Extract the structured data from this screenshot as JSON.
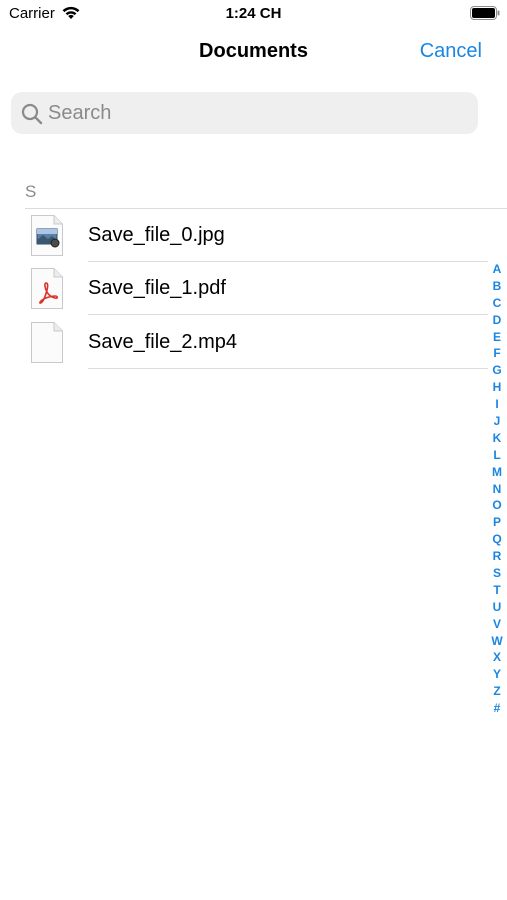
{
  "status_bar": {
    "carrier": "Carrier",
    "time": "1:24 CH"
  },
  "nav": {
    "title": "Documents",
    "cancel_label": "Cancel"
  },
  "search": {
    "placeholder": "Search",
    "value": ""
  },
  "section": {
    "header": "S"
  },
  "files": [
    {
      "name": "Save_file_0.jpg",
      "icon": "image-file-icon"
    },
    {
      "name": "Save_file_1.pdf",
      "icon": "pdf-file-icon"
    },
    {
      "name": "Save_file_2.mp4",
      "icon": "generic-file-icon"
    }
  ],
  "index": [
    "A",
    "B",
    "C",
    "D",
    "E",
    "F",
    "G",
    "H",
    "I",
    "J",
    "K",
    "L",
    "M",
    "N",
    "O",
    "P",
    "Q",
    "R",
    "S",
    "T",
    "U",
    "V",
    "W",
    "X",
    "Y",
    "Z",
    "#"
  ],
  "colors": {
    "accent": "#1a86e3",
    "search_bg": "#efeff0",
    "secondary_text": "#8a8a8e",
    "separator": "#dcdcde",
    "pdf_red": "#d9332b"
  }
}
